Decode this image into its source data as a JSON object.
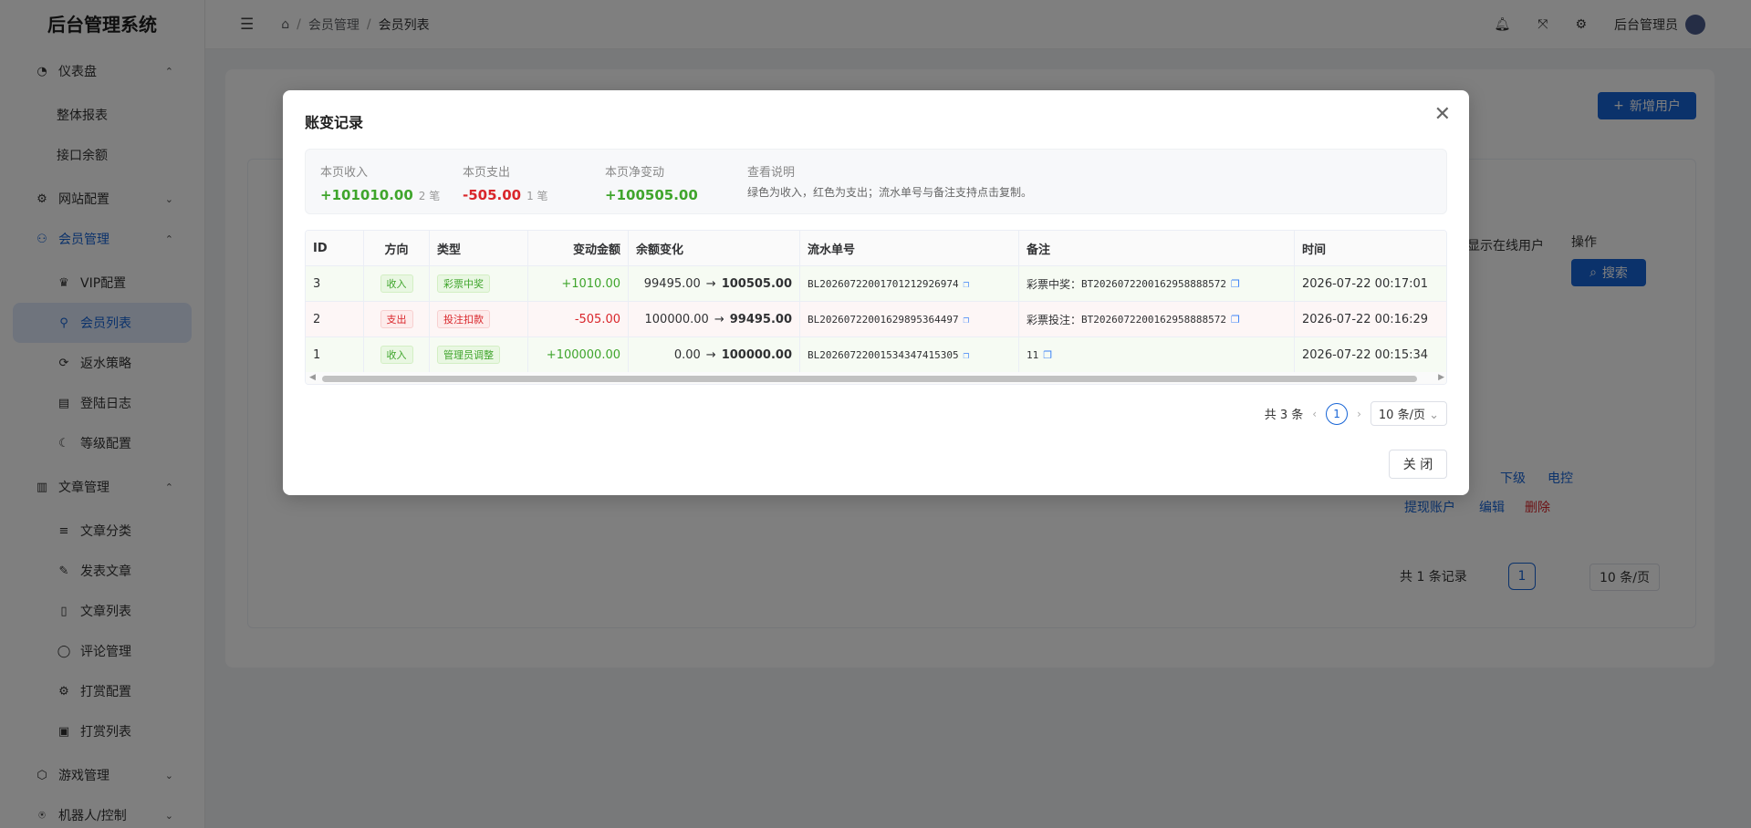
{
  "app": {
    "title": "后台管理系统"
  },
  "sidebar": {
    "items": [
      {
        "label": "仪表盘",
        "icon": "dashboard-icon",
        "chev": "⌃"
      },
      {
        "label": "整体报表"
      },
      {
        "label": "接口余额"
      },
      {
        "label": "网站配置",
        "icon": "gear-icon",
        "chev": "⌄"
      },
      {
        "label": "会员管理",
        "icon": "members-icon",
        "chev": "⌃"
      },
      {
        "label": "VIP配置",
        "icon": "crown-icon"
      },
      {
        "label": "会员列表",
        "icon": "user-icon"
      },
      {
        "label": "返水策略",
        "icon": "rebate-icon"
      },
      {
        "label": "登陆日志",
        "icon": "log-icon"
      },
      {
        "label": "等级配置",
        "icon": "moon-icon"
      },
      {
        "label": "文章管理",
        "icon": "book-icon",
        "chev": "⌃"
      },
      {
        "label": "文章分类",
        "icon": "list-icon"
      },
      {
        "label": "发表文章",
        "icon": "pen-icon"
      },
      {
        "label": "文章列表",
        "icon": "doc-icon"
      },
      {
        "label": "评论管理",
        "icon": "comment-icon"
      },
      {
        "label": "打赏配置",
        "icon": "gear-icon"
      },
      {
        "label": "打赏列表",
        "icon": "reward-icon"
      },
      {
        "label": "游戏管理",
        "icon": "cube-icon",
        "chev": "⌄"
      },
      {
        "label": "机器人/控制",
        "icon": "robot-icon",
        "chev": "⌄"
      }
    ]
  },
  "header": {
    "breadcrumb": [
      "会员管理",
      "会员列表"
    ],
    "user": "后台管理员"
  },
  "background": {
    "add_user": "新增用户",
    "show_online": "显示在线用户",
    "actions_label": "操作",
    "search": "搜索",
    "links": [
      "下级",
      "电控",
      "提现账户",
      "编辑",
      "删除"
    ],
    "total": "共 1 条记录",
    "page": "1",
    "page_size": "10 条/页"
  },
  "modal": {
    "title": "账变记录",
    "summary": {
      "income_label": "本页收入",
      "income_value": "+101010.00",
      "income_count": "2 笔",
      "expense_label": "本页支出",
      "expense_value": "-505.00",
      "expense_count": "1 笔",
      "net_label": "本页净变动",
      "net_value": "+100505.00",
      "note_label": "查看说明",
      "note_text": "绿色为收入，红色为支出；流水单号与备注支持点击复制。"
    },
    "columns": [
      "ID",
      "方向",
      "类型",
      "变动金额",
      "余额变化",
      "流水单号",
      "备注",
      "时间"
    ],
    "rows": [
      {
        "id": "3",
        "dir": "收入",
        "type": "彩票中奖",
        "amount": "+1010.00",
        "bal_from": "99495.00",
        "bal_to": "100505.00",
        "sn": "BL202607220017012129269​74",
        "memo_prefix": "彩票中奖：",
        "memo": "BT202607220016295888857​2",
        "time": "2026-07-22 00:17:01"
      },
      {
        "id": "2",
        "dir": "支出",
        "type": "投注扣款",
        "amount": "-505.00",
        "bal_from": "100000.00",
        "bal_to": "99495.00",
        "sn": "BL20260722001629895364497",
        "memo_prefix": "彩票投注：",
        "memo": "BT2026072200162958888572",
        "time": "2026-07-22 00:16:29"
      },
      {
        "id": "1",
        "dir": "收入",
        "type": "管理员调整",
        "amount": "+100000.00",
        "bal_from": "0.00",
        "bal_to": "100000.00",
        "sn": "BL20260722001534347415305",
        "memo_prefix": "",
        "memo": "11",
        "time": "2026-07-22 00:15:34"
      }
    ],
    "pager": {
      "total": "共 3 条",
      "page": "1",
      "size": "10 条/页"
    },
    "close": "关 闭"
  }
}
